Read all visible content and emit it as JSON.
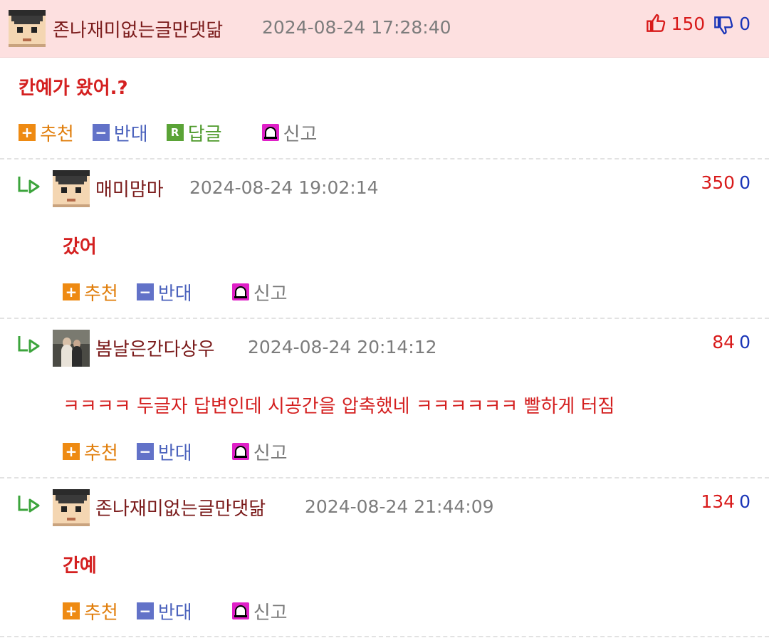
{
  "actions": {
    "recommend": "추천",
    "oppose": "반대",
    "reply": "답글",
    "report": "신고",
    "reply_badge": "R"
  },
  "parent": {
    "nickname": "존나재미없는글만댓닮",
    "datetime": "2024-08-24 17:28:40",
    "upvotes": "150",
    "downvotes": "0",
    "text": "칸예가 왔어.?"
  },
  "replies": [
    {
      "nickname": "매미맘마",
      "datetime": "2024-08-24 19:02:14",
      "upvotes": "350",
      "downvotes": "0",
      "text": "갔어"
    },
    {
      "nickname": "봄날은간다상우",
      "datetime": "2024-08-24 20:14:12",
      "upvotes": "84",
      "downvotes": "0",
      "text": "ㅋㅋㅋㅋ 두글자 답변인데 시공간을 압축했네 ㅋㅋㅋㅋㅋㅋ 빨하게 터짐"
    },
    {
      "nickname": "존나재미없는글만댓닮",
      "datetime": "2024-08-24 21:44:09",
      "upvotes": "134",
      "downvotes": "0",
      "text": "간예"
    }
  ],
  "colors": {
    "header_bg": "#fde0e0",
    "nick": "#7a1a1a",
    "body_text": "#d42020",
    "up": "#d81a1a",
    "down": "#1a35b8",
    "recommend": "#ee8a12",
    "oppose": "#6272c8",
    "reply": "#5aa336",
    "report": "#e020c8"
  },
  "icons": [
    "pixel-avatar-icon",
    "photo-avatar-icon",
    "thumbs-up-icon",
    "thumbs-down-icon",
    "plus-icon",
    "minus-icon",
    "reply-r-icon",
    "siren-icon",
    "reply-arrow-icon"
  ]
}
